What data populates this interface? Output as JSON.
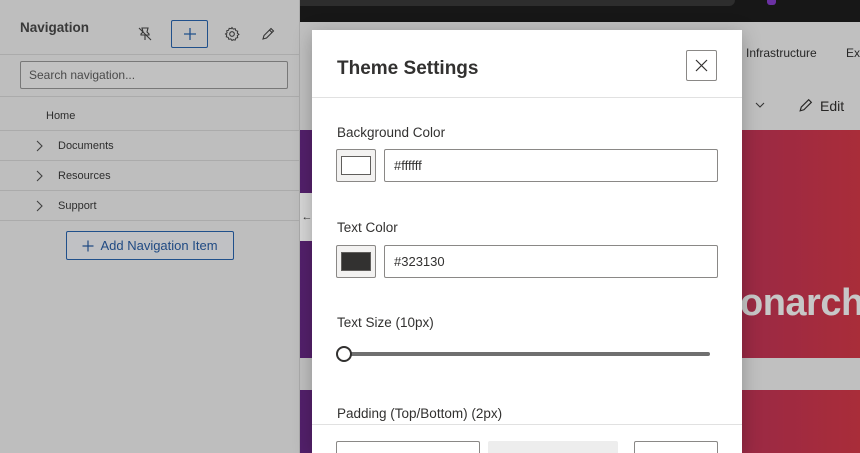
{
  "nav": {
    "title": "Navigation",
    "search_placeholder": "Search navigation...",
    "items": [
      {
        "label": "Home",
        "expandable": false
      },
      {
        "label": "Documents",
        "expandable": true
      },
      {
        "label": "Resources",
        "expandable": true
      },
      {
        "label": "Support",
        "expandable": true
      }
    ],
    "add_button_label": "Add Navigation Item",
    "tools": [
      "unpin-icon",
      "add-icon",
      "gear-icon",
      "pencil-icon"
    ]
  },
  "background": {
    "nav_links": [
      "Infrastructure",
      "Ex"
    ],
    "edit_label": "Edit",
    "hero_text": "onarch",
    "hero_colors": [
      "#6a2a8a",
      "#b0306a",
      "#d93a4a"
    ]
  },
  "modal": {
    "title": "Theme Settings",
    "background_color": {
      "label": "Background Color",
      "value": "#ffffff",
      "swatch": "#ffffff"
    },
    "text_color": {
      "label": "Text Color",
      "value": "#323130",
      "swatch": "#323130"
    },
    "text_size": {
      "label": "Text Size (10px)",
      "slider_value_fraction": 0
    },
    "padding": {
      "label": "Padding (Top/Bottom) (2px)"
    }
  },
  "colors": {
    "accent": "#2a67b3",
    "text": "#323130"
  }
}
